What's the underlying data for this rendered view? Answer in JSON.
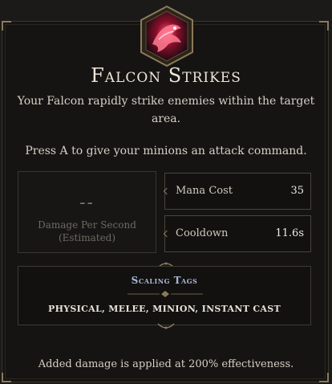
{
  "skill": {
    "icon": "falcon-strikes-icon",
    "title": "Falcon Strikes",
    "description": "Your Falcon rapidly strike enemies within the target area.",
    "command_hint": "Press A to give your minions an attack command."
  },
  "dps": {
    "value": "--",
    "label": "Damage Per Second (Estimated)"
  },
  "stats": [
    {
      "label": "Mana Cost",
      "value": "35"
    },
    {
      "label": "Cooldown",
      "value": "11.6s"
    }
  ],
  "tags": {
    "title": "Scaling Tags",
    "list": "PHYSICAL, MELEE, MINION, INSTANT CAST"
  },
  "footer": "Added damage is applied at 200% effectiveness.",
  "colors": {
    "background": "#151413",
    "accent_gold": "#8a7a5a",
    "tags_title": "#a9b7d8",
    "icon_red": "#c2223b"
  }
}
